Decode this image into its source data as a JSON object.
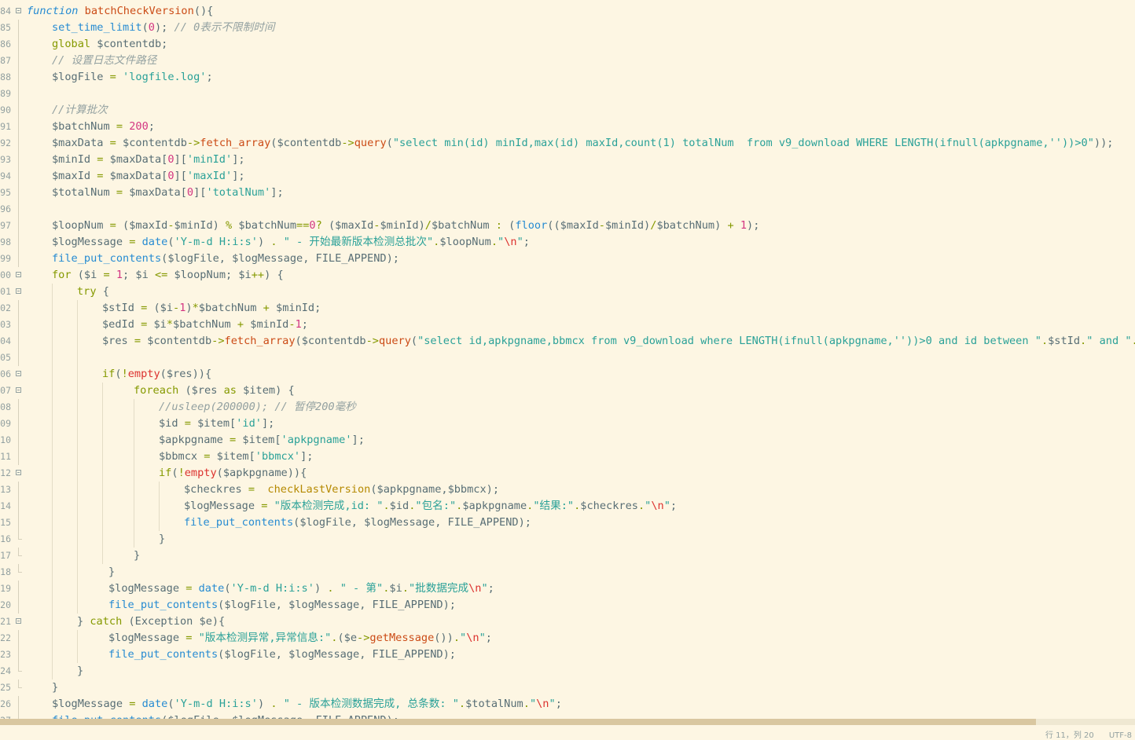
{
  "editor": {
    "lines": [
      {
        "n": "84",
        "fold": "open",
        "guides": [],
        "indent": 0,
        "html": "<span class=\"fn-kw\">function</span> <span class=\"fn\">batchCheckVersion</span>(){"
      },
      {
        "n": "85",
        "fold": "line",
        "guides": [],
        "indent": 1,
        "html": "<span class=\"bi\">set_time_limit</span>(<span class=\"num\">0</span>); <span class=\"cm\">// 0表示不限制时间</span>"
      },
      {
        "n": "86",
        "fold": "line",
        "guides": [],
        "indent": 1,
        "html": "<span class=\"kw\">global</span> $contentdb;"
      },
      {
        "n": "87",
        "fold": "line",
        "guides": [],
        "indent": 1,
        "html": "<span class=\"cm\">// 设置日志文件路径</span>"
      },
      {
        "n": "88",
        "fold": "line",
        "guides": [],
        "indent": 1,
        "html": "$logFile <span class=\"op\">=</span> <span class=\"str\">'logfile.log'</span>;"
      },
      {
        "n": "89",
        "fold": "line",
        "guides": [],
        "indent": 1,
        "html": ""
      },
      {
        "n": "90",
        "fold": "line",
        "guides": [],
        "indent": 1,
        "html": "<span class=\"cm\">//计算批次</span>"
      },
      {
        "n": "91",
        "fold": "line",
        "guides": [],
        "indent": 1,
        "html": "$batchNum <span class=\"op\">=</span> <span class=\"num\">200</span>;"
      },
      {
        "n": "92",
        "fold": "line",
        "guides": [],
        "indent": 1,
        "html": "$maxData <span class=\"op\">=</span> $contentdb<span class=\"op\">-&gt;</span><span class=\"fn\">fetch_array</span>($contentdb<span class=\"op\">-&gt;</span><span class=\"fn\">query</span>(<span class=\"str\">\"select min(id) minId,max(id) maxId,count(1) totalNum  from v9_download WHERE LENGTH(ifnull(apkpgname,''))&gt;0\"</span>));"
      },
      {
        "n": "93",
        "fold": "line",
        "guides": [],
        "indent": 1,
        "html": "$minId <span class=\"op\">=</span> $maxData[<span class=\"num\">0</span>][<span class=\"str\">'minId'</span>];"
      },
      {
        "n": "94",
        "fold": "line",
        "guides": [],
        "indent": 1,
        "html": "$maxId <span class=\"op\">=</span> $maxData[<span class=\"num\">0</span>][<span class=\"str\">'maxId'</span>];"
      },
      {
        "n": "95",
        "fold": "line",
        "guides": [],
        "indent": 1,
        "html": "$totalNum <span class=\"op\">=</span> $maxData[<span class=\"num\">0</span>][<span class=\"str\">'totalNum'</span>];"
      },
      {
        "n": "96",
        "fold": "line",
        "guides": [],
        "indent": 1,
        "html": ""
      },
      {
        "n": "97",
        "fold": "line",
        "guides": [],
        "indent": 1,
        "html": "$loopNum <span class=\"op\">=</span> ($maxId<span class=\"op\">-</span>$minId) <span class=\"op\">%</span> $batchNum<span class=\"op\">==</span><span class=\"num\">0</span><span class=\"op\">?</span> ($maxId<span class=\"op\">-</span>$minId)<span class=\"op\">/</span>$batchNum <span class=\"op\">:</span> (<span class=\"bi\">floor</span>(($maxId<span class=\"op\">-</span>$minId)<span class=\"op\">/</span>$batchNum) <span class=\"op\">+</span> <span class=\"num\">1</span>);"
      },
      {
        "n": "98",
        "fold": "line",
        "guides": [],
        "indent": 1,
        "html": "$logMessage <span class=\"op\">=</span> <span class=\"bi\">date</span>(<span class=\"str\">'Y-m-d H:i:s'</span>) <span class=\"op\">.</span> <span class=\"str\">\" - 开始最新版本检测总批次\"</span><span class=\"op\">.</span>$loopNum<span class=\"op\">.</span><span class=\"str\">\"<span class=\"red\">\\n</span>\"</span>;"
      },
      {
        "n": "99",
        "fold": "line",
        "guides": [],
        "indent": 1,
        "html": "<span class=\"bi\">file_put_contents</span>($logFile, $logMessage, FILE_APPEND);"
      },
      {
        "n": "00",
        "fold": "open",
        "guides": [],
        "indent": 1,
        "html": "<span class=\"kw\">for</span> ($i <span class=\"op\">=</span> <span class=\"num\">1</span>; $i <span class=\"op\">&lt;=</span> $loopNum; $i<span class=\"op\">++</span>) {"
      },
      {
        "n": "01",
        "fold": "open",
        "guides": [
          66
        ],
        "indent": 2,
        "html": "<span class=\"kw\">try</span> {"
      },
      {
        "n": "02",
        "fold": "line",
        "guides": [
          66,
          98
        ],
        "indent": 3,
        "html": "$stId <span class=\"op\">=</span> ($i<span class=\"op\">-</span><span class=\"num\">1</span>)<span class=\"op\">*</span>$batchNum <span class=\"op\">+</span> $minId;"
      },
      {
        "n": "03",
        "fold": "line",
        "guides": [
          66,
          98
        ],
        "indent": 3,
        "html": "$edId <span class=\"op\">=</span> $i<span class=\"op\">*</span>$batchNum <span class=\"op\">+</span> $minId<span class=\"op\">-</span><span class=\"num\">1</span>;"
      },
      {
        "n": "04",
        "fold": "line",
        "guides": [
          66,
          98
        ],
        "indent": 3,
        "html": "$res <span class=\"op\">=</span> $contentdb<span class=\"op\">-&gt;</span><span class=\"fn\">fetch_array</span>($contentdb<span class=\"op\">-&gt;</span><span class=\"fn\">query</span>(<span class=\"str\">\"select id,apkpgname,bbmcx from v9_download where LENGTH(ifnull(apkpgname,''))&gt;0 and id between \"</span><span class=\"op\">.</span>$stId<span class=\"op\">.</span><span class=\"str\">\" and \"</span><span class=\"op\">.</span>$edId"
      },
      {
        "n": "05",
        "fold": "line",
        "guides": [
          66,
          98
        ],
        "indent": 3,
        "html": ""
      },
      {
        "n": "06",
        "fold": "open",
        "guides": [
          66,
          98
        ],
        "indent": 3,
        "html": "<span class=\"kw\">if</span>(<span class=\"op\">!</span><span class=\"red\">empty</span>($res)){"
      },
      {
        "n": "07",
        "fold": "open",
        "guides": [
          66,
          98,
          130
        ],
        "indent": 4.25,
        "html": "<span class=\"kw\">foreach</span> ($res <span class=\"kw\">as</span> $item) {"
      },
      {
        "n": "08",
        "fold": "line",
        "guides": [
          66,
          98,
          130,
          170
        ],
        "indent": 5.25,
        "html": "<span class=\"cm\">//usleep(200000); // 暂停200毫秒</span>"
      },
      {
        "n": "09",
        "fold": "line",
        "guides": [
          66,
          98,
          130,
          170
        ],
        "indent": 5.25,
        "html": "$id <span class=\"op\">=</span> $item[<span class=\"str\">'id'</span>];"
      },
      {
        "n": "10",
        "fold": "line",
        "guides": [
          66,
          98,
          130,
          170
        ],
        "indent": 5.25,
        "html": "$apkpgname <span class=\"op\">=</span> $item[<span class=\"str\">'apkpgname'</span>];"
      },
      {
        "n": "11",
        "fold": "line",
        "guides": [
          66,
          98,
          130,
          170
        ],
        "indent": 5.25,
        "html": "$bbmcx <span class=\"op\">=</span> $item[<span class=\"str\">'bbmcx'</span>];"
      },
      {
        "n": "12",
        "fold": "open",
        "guides": [
          66,
          98,
          130,
          170
        ],
        "indent": 5.25,
        "html": "<span class=\"kw\">if</span>(<span class=\"op\">!</span><span class=\"red\">empty</span>($apkpgname)){"
      },
      {
        "n": "13",
        "fold": "line",
        "guides": [
          66,
          98,
          130,
          170,
          202
        ],
        "indent": 6.25,
        "html": "$checkres <span class=\"op\">=</span>  <span class=\"cls\">checkLastVersion</span>($apkpgname,$bbmcx);"
      },
      {
        "n": "14",
        "fold": "line",
        "guides": [
          66,
          98,
          130,
          170,
          202
        ],
        "indent": 6.25,
        "html": "$logMessage <span class=\"op\">=</span> <span class=\"str\">\"版本检测完成,id: \"</span><span class=\"op\">.</span>$id<span class=\"op\">.</span><span class=\"str\">\"包名:\"</span><span class=\"op\">.</span>$apkpgname<span class=\"op\">.</span><span class=\"str\">\"结果:\"</span><span class=\"op\">.</span>$checkres<span class=\"op\">.</span><span class=\"str\">\"<span class=\"red\">\\n</span>\"</span>;"
      },
      {
        "n": "15",
        "fold": "line",
        "guides": [
          66,
          98,
          130,
          170,
          202
        ],
        "indent": 6.25,
        "html": "<span class=\"bi\">file_put_contents</span>($logFile, $logMessage, FILE_APPEND);"
      },
      {
        "n": "16",
        "fold": "end",
        "guides": [
          66,
          98,
          130,
          170
        ],
        "indent": 5.25,
        "html": "}"
      },
      {
        "n": "17",
        "fold": "end",
        "guides": [
          66,
          98,
          130
        ],
        "indent": 4.25,
        "html": "}"
      },
      {
        "n": "18",
        "fold": "end",
        "guides": [
          66,
          98
        ],
        "indent": 3.25,
        "html": "}"
      },
      {
        "n": "19",
        "fold": "line",
        "guides": [
          66,
          98
        ],
        "indent": 3.25,
        "html": "$logMessage <span class=\"op\">=</span> <span class=\"bi\">date</span>(<span class=\"str\">'Y-m-d H:i:s'</span>) <span class=\"op\">.</span> <span class=\"str\">\" - 第\"</span><span class=\"op\">.</span>$i<span class=\"op\">.</span><span class=\"str\">\"批数据完成<span class=\"red\">\\n</span>\"</span>;"
      },
      {
        "n": "20",
        "fold": "line",
        "guides": [
          66,
          98
        ],
        "indent": 3.25,
        "html": "<span class=\"bi\">file_put_contents</span>($logFile, $logMessage, FILE_APPEND);"
      },
      {
        "n": "21",
        "fold": "open",
        "guides": [
          66
        ],
        "indent": 2,
        "html": "} <span class=\"kw\">catch</span> (Exception $e){"
      },
      {
        "n": "22",
        "fold": "line",
        "guides": [
          66,
          98
        ],
        "indent": 3.25,
        "html": "$logMessage <span class=\"op\">=</span> <span class=\"str\">\"版本检测异常,异常信息:\"</span><span class=\"op\">.</span>($e<span class=\"op\">-&gt;</span><span class=\"fn\">getMessage</span>())<span class=\"op\">.</span><span class=\"str\">\"<span class=\"red\">\\n</span>\"</span>;"
      },
      {
        "n": "23",
        "fold": "line",
        "guides": [
          66,
          98
        ],
        "indent": 3.25,
        "html": "<span class=\"bi\">file_put_contents</span>($logFile, $logMessage, FILE_APPEND);"
      },
      {
        "n": "24",
        "fold": "end",
        "guides": [
          66
        ],
        "indent": 2,
        "html": "}"
      },
      {
        "n": "25",
        "fold": "end",
        "guides": [],
        "indent": 1,
        "html": "}"
      },
      {
        "n": "26",
        "fold": "line",
        "guides": [],
        "indent": 1,
        "html": "$logMessage <span class=\"op\">=</span> <span class=\"bi\">date</span>(<span class=\"str\">'Y-m-d H:i:s'</span>) <span class=\"op\">.</span> <span class=\"str\">\" - 版本检测数据完成, 总条数: \"</span><span class=\"op\">.</span>$totalNum<span class=\"op\">.</span><span class=\"str\">\"<span class=\"red\">\\n</span>\"</span>;"
      },
      {
        "n": "27",
        "fold": "line",
        "guides": [],
        "indent": 1,
        "html": "<span class=\"bi\">file_put_contents</span>($logFile, $logMessage, FILE_APPEND);"
      }
    ]
  },
  "statusbar": {
    "text": "行 11，列 20      UTF-8"
  }
}
